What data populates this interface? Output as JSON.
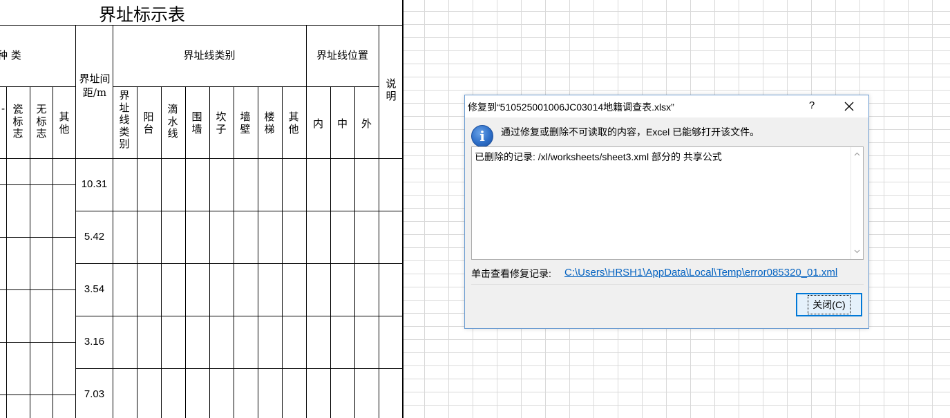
{
  "sheet": {
    "title": "界址标示表",
    "headers": {
      "zhong_lei": "种 类",
      "jie_zhi_jian_ju": "界址间距/m",
      "jie_zhi_xian_lei_bie": "界址线类别",
      "jie_zhi_xian_wei_zhi": "界址线位置",
      "shuo_ming": "说明",
      "partial_left": "-",
      "ci_biao_zhi": "瓷标志",
      "wu_biao_zhi": "无标志",
      "qi_ta_1": "其他",
      "line_type": "界址线类别",
      "yang_tai": "阳台",
      "di_shui_xian": "滴水线",
      "wei_qiang": "围墙",
      "kan_zi": "坎子",
      "qiang_bi": "墙壁",
      "lou_ti": "楼梯",
      "qi_ta_2": "其他",
      "nei": "内",
      "zhong": "中",
      "wai": "外"
    },
    "distances": [
      "10.31",
      "5.42",
      "3.54",
      "3.16",
      "7.03"
    ]
  },
  "dialog": {
    "title": "修复到“510525001006JC03014地籍调查表.xlsx”",
    "help_label": "?",
    "close_icon": "close-icon",
    "icon": "info-icon",
    "icon_glyph": "i",
    "message": "通过修复或删除不可读取的内容，Excel 已能够打开该文件。",
    "log_text": "已删除的记录: /xl/worksheets/sheet3.xml 部分的 共享公式",
    "link_label": "单击查看修复记录:",
    "link_text": "C:\\Users\\HRSH1\\AppData\\Local\\Temp\\error085320_01.xml",
    "close_button": "关闭(C)",
    "accent": "#0078d7",
    "link_color": "#0563c1"
  }
}
